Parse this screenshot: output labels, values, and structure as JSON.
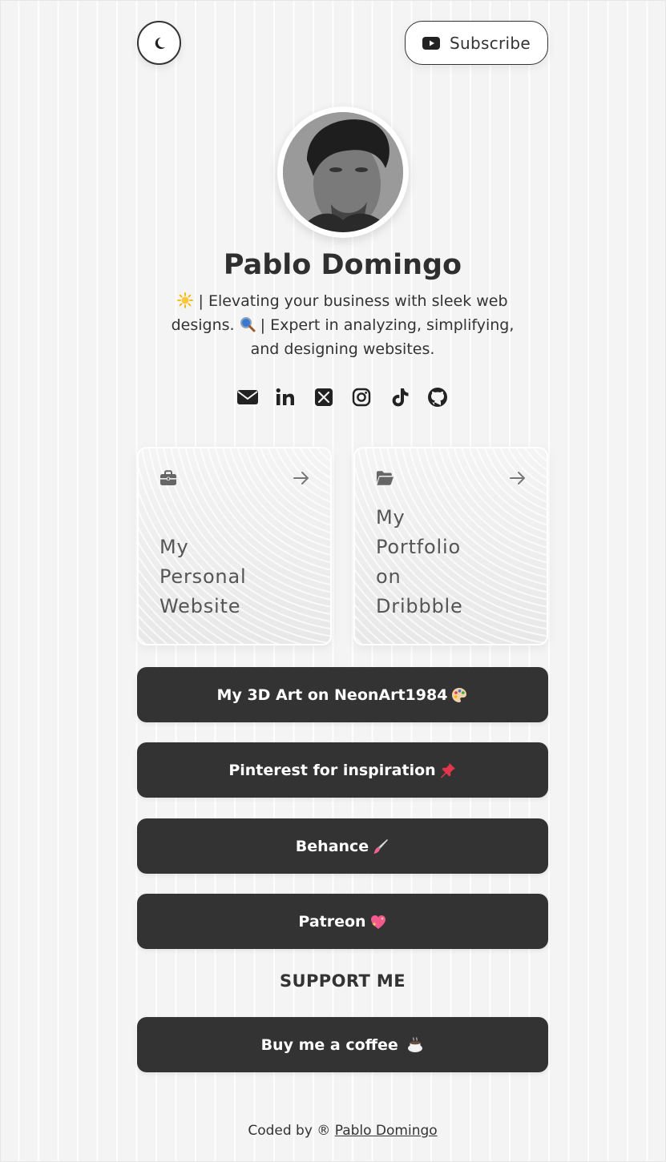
{
  "header": {
    "theme_toggle_icon": "moon-icon",
    "subscribe_label": "Subscribe",
    "subscribe_icon": "youtube-icon"
  },
  "profile": {
    "name": "Pablo Domingo",
    "bio_part1": " | Elevating your business with sleek web designs. ",
    "bio_part2": " | Expert in analyzing, simplifying, and designing websites."
  },
  "socials": [
    {
      "name": "email-icon"
    },
    {
      "name": "linkedin-icon"
    },
    {
      "name": "x-twitter-icon"
    },
    {
      "name": "instagram-icon"
    },
    {
      "name": "tiktok-icon"
    },
    {
      "name": "github-icon"
    }
  ],
  "cards": [
    {
      "label": "My Personal Website",
      "icon": "briefcase-icon"
    },
    {
      "label": "My Portfolio on Dribbble",
      "icon": "folder-open-icon"
    }
  ],
  "links": [
    {
      "label": "My 3D Art on NeonArt1984",
      "emoji": "palette-emoji"
    },
    {
      "label": "Pinterest for inspiration",
      "emoji": "pushpin-emoji"
    },
    {
      "label": "Behance",
      "emoji": "paintbrush-emoji"
    },
    {
      "label": "Patreon",
      "emoji": "sparkling-heart-emoji"
    }
  ],
  "support": {
    "title": "SUPPORT ME",
    "coffee_label": "Buy me a coffee ",
    "coffee_emoji": "hot-beverage-emoji"
  },
  "footer": {
    "prefix": "Coded by ® ",
    "author": "Pablo Domingo"
  },
  "colors": {
    "background": "#f4f4f4",
    "button_dark": "#333333",
    "text": "#2b2b2b"
  }
}
